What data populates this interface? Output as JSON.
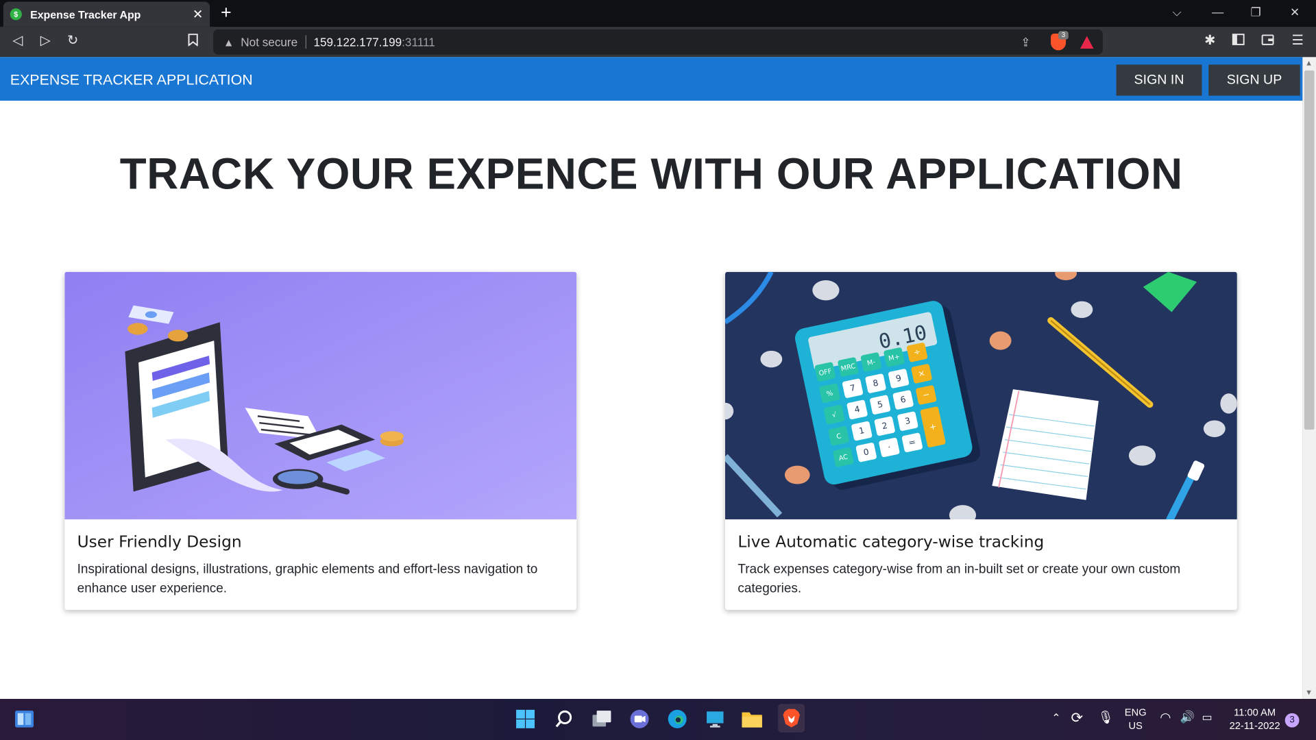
{
  "browser": {
    "tab_title": "Expense Tracker App",
    "tab_favicon": "$",
    "security_text": "Not secure",
    "url_host": "159.122.177.199",
    "url_port": ":31111",
    "shield_count": "3"
  },
  "page": {
    "brand": "EXPENSE TRACKER APPLICATION",
    "sign_in": "SIGN IN",
    "sign_up": "SIGN UP",
    "hero_title": "TRACK YOUR EXPENCE WITH OUR APPLICATION",
    "cards": [
      {
        "title": "User Friendly Design",
        "text": "Inspirational designs, illustrations, graphic elements and effort-less navigation to enhance user experience."
      },
      {
        "title": "Live Automatic category-wise tracking",
        "text": "Track expenses category-wise from an in-built set or create your own custom categories."
      }
    ],
    "calculator_display": "0.10",
    "calculator_keys": [
      "OFF",
      "MRC",
      "M-",
      "M+",
      "÷",
      "%",
      "7",
      "8",
      "9",
      "×",
      "√",
      "4",
      "5",
      "6",
      "−",
      "C",
      "1",
      "2",
      "3",
      "+",
      "AC",
      "0",
      "·",
      "="
    ]
  },
  "taskbar": {
    "lang_top": "ENG",
    "lang_bottom": "US",
    "time": "11:00 AM",
    "date": "22-11-2022",
    "notification_count": "3"
  },
  "colors": {
    "navbar": "#1976d2",
    "nav_button": "#343a40",
    "card1_bg": "#9b8ef5",
    "card2_bg": "#23345f"
  }
}
